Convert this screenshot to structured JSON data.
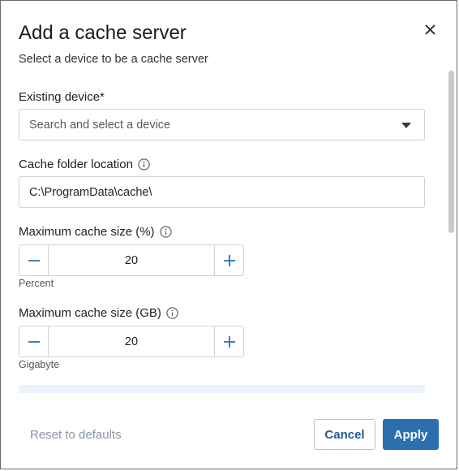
{
  "dialog": {
    "title": "Add a cache server",
    "subtitle": "Select a device to be a cache server",
    "close_icon": "close-icon"
  },
  "existing_device": {
    "label": "Existing device*",
    "placeholder": "Search and select a device"
  },
  "cache_folder": {
    "label": "Cache folder location",
    "value": "C:\\ProgramData\\cache\\"
  },
  "max_percent": {
    "label": "Maximum cache size (%)",
    "value": "20",
    "helper": "Percent"
  },
  "max_gb": {
    "label": "Maximum cache size (GB)",
    "value": "20",
    "helper": "Gigabyte"
  },
  "footer": {
    "reset_label": "Reset to defaults",
    "cancel_label": "Cancel",
    "apply_label": "Apply"
  },
  "colors": {
    "accent": "#2d6fae",
    "stepper_icon": "#2d6fae"
  }
}
